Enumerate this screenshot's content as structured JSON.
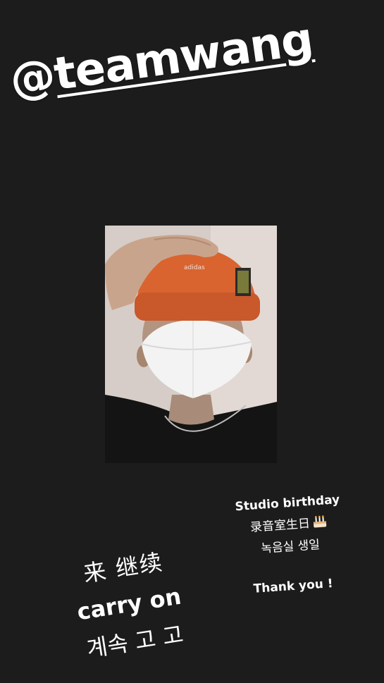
{
  "mention": {
    "at": "@",
    "handle": "teamwang"
  },
  "photo": {
    "alt": "selfie photo"
  },
  "note_right": {
    "line1": "Studio birthday",
    "line2": "录音室生日",
    "line3": "녹음실 생일",
    "line4": "Thank you !"
  },
  "note_left": {
    "line1": "来 继续",
    "line2": "carry on",
    "line3": "계속 고 고"
  },
  "colors": {
    "background": "#1c1c1c",
    "text": "#ffffff",
    "beanie": "#d9642f"
  }
}
